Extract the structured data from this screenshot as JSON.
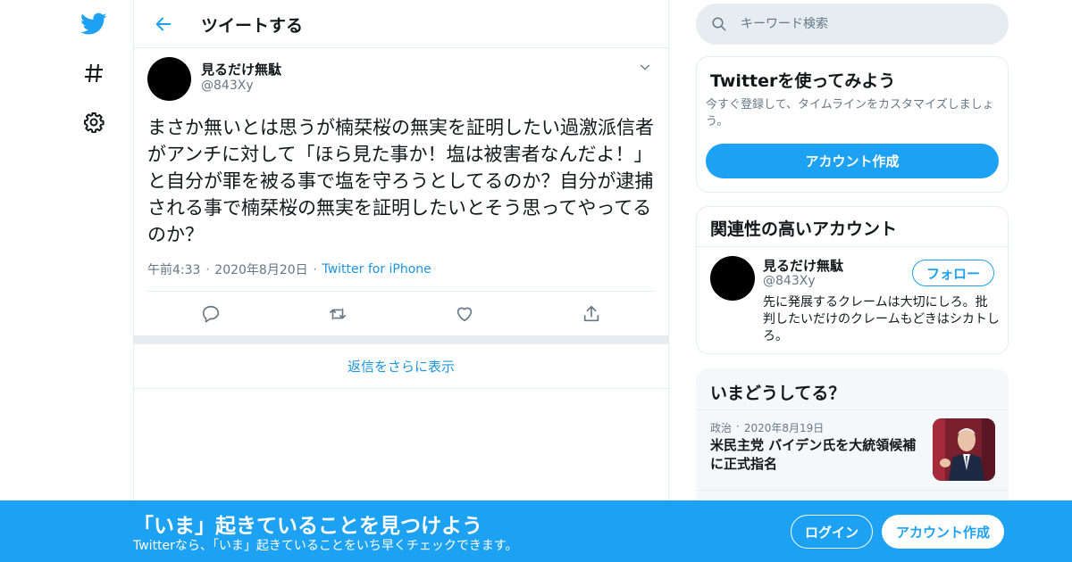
{
  "colors": {
    "accent": "#1da1f2",
    "link": "#1b95e0",
    "text_primary": "#14171a",
    "text_secondary": "#657786",
    "border": "#e6ecf0"
  },
  "nav": {
    "icons": [
      "twitter-bird-icon",
      "hashtag-icon",
      "settings-gear-icon"
    ]
  },
  "header": {
    "back_icon": "arrow-left-icon",
    "title": "ツイートする"
  },
  "tweet": {
    "author_name": "見るだけ無駄",
    "author_handle": "@843Xy",
    "text": "まさか無いとは思うが楠栞桜の無実を証明したい過激派信者がアンチに対して「ほら見た事か！塩は被害者なんだよ！」と自分が罪を被る事で塩を守ろうとしてるのか？自分が逮捕される事で楠栞桜の無実を証明したいとそう思ってやってるのか？",
    "time": "午前4:33",
    "date": "2020年8月20日",
    "source": "Twitter for iPhone",
    "separator": "·",
    "action_icons": [
      "reply-icon",
      "retweet-icon",
      "like-heart-icon",
      "share-icon"
    ]
  },
  "more_replies": "返信をさらに表示",
  "search": {
    "placeholder": "キーワード検索"
  },
  "signup_card": {
    "title": "Twitterを使ってみよう",
    "description": "今すぐ登録して、タイムラインをカスタマイズしましょう。",
    "button": "アカウント作成"
  },
  "related_card": {
    "title": "関連性の高いアカウント",
    "name": "見るだけ無駄",
    "handle": "@843Xy",
    "follow_button": "フォロー",
    "bio": "先に発展するクレームは大切にしろ。批判したいだけのクレームもどきはシカトしろ。"
  },
  "trends_card": {
    "title": "いまどうしてる？",
    "category": "政治",
    "separator": "·",
    "date": "2020年8月19日",
    "headline": "米民主党 バイデン氏を大統領候補に正式指名"
  },
  "banner": {
    "title": "「いま」起きていることを見つけよう",
    "subtitle": "Twitterなら、「いま」起きていることをいち早くチェックできます。",
    "login_button": "ログイン",
    "signup_button": "アカウント作成"
  }
}
